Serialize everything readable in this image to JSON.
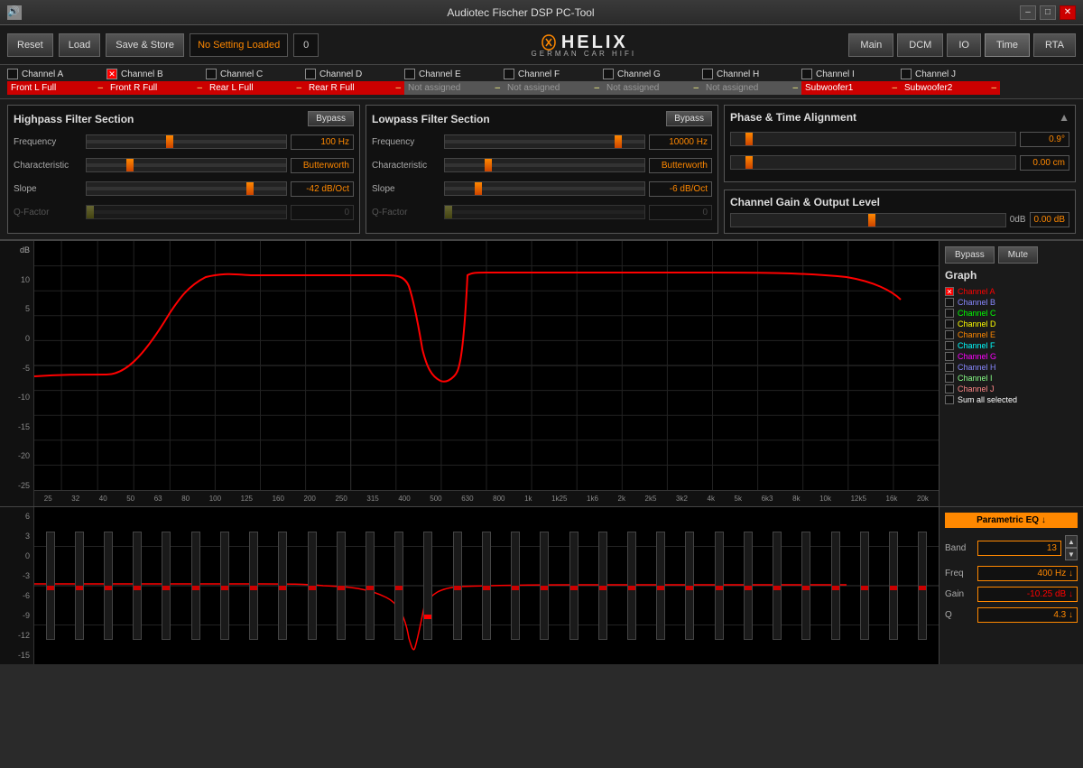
{
  "titlebar": {
    "title": "Audiotec Fischer DSP PC-Tool",
    "minimize_label": "–",
    "maximize_label": "□",
    "close_label": "✕"
  },
  "toolbar": {
    "reset_label": "Reset",
    "load_label": "Load",
    "save_label": "Save & Store",
    "no_setting_label": "No Setting Loaded",
    "setting_num": "0",
    "nav": {
      "main_label": "Main",
      "dcm_label": "DCM",
      "io_label": "IO",
      "time_label": "Time",
      "rta_label": "RTA"
    }
  },
  "channels": [
    {
      "id": "A",
      "label": "Channel A",
      "checked": false,
      "value": "Front L Full",
      "active": true
    },
    {
      "id": "B",
      "label": "Channel B",
      "checked": true,
      "value": "Front R Full",
      "active": true
    },
    {
      "id": "C",
      "label": "Channel C",
      "checked": false,
      "value": "Rear L Full",
      "active": true
    },
    {
      "id": "D",
      "label": "Channel D",
      "checked": false,
      "value": "Rear R Full",
      "active": true
    },
    {
      "id": "E",
      "label": "Channel E",
      "checked": false,
      "value": "Not assigned",
      "active": false
    },
    {
      "id": "F",
      "label": "Channel F",
      "checked": false,
      "value": "Not assigned",
      "active": false
    },
    {
      "id": "G",
      "label": "Channel G",
      "checked": false,
      "value": "Not assigned",
      "active": false
    },
    {
      "id": "H",
      "label": "Channel H",
      "checked": false,
      "value": "Not assigned",
      "active": false
    },
    {
      "id": "I",
      "label": "Channel I",
      "checked": false,
      "value": "Subwoofer1",
      "active": true
    },
    {
      "id": "J",
      "label": "Channel J",
      "checked": false,
      "value": "Subwoofer2",
      "active": true
    }
  ],
  "highpass": {
    "title": "Highpass Filter Section",
    "bypass_label": "Bypass",
    "frequency_label": "Frequency",
    "frequency_value": "100 Hz",
    "characteristic_label": "Characteristic",
    "characteristic_value": "Butterworth",
    "slope_label": "Slope",
    "slope_value": "-42 dB/Oct",
    "qfactor_label": "Q-Factor",
    "qfactor_value": "0"
  },
  "lowpass": {
    "title": "Lowpass Filter Section",
    "bypass_label": "Bypass",
    "frequency_label": "Frequency",
    "frequency_value": "10000 Hz",
    "characteristic_label": "Characteristic",
    "characteristic_value": "Butterworth",
    "slope_label": "Slope",
    "slope_value": "-6 dB/Oct",
    "qfactor_label": "Q-Factor",
    "qfactor_value": "0"
  },
  "phase_time": {
    "title": "Phase & Time Alignment",
    "phase_value": "0.9°",
    "distance_value": "0.00 cm",
    "scroll_arrow": "▲"
  },
  "channel_gain": {
    "title": "Channel Gain & Output Level",
    "db_label": "0dB",
    "value": "0.00 dB"
  },
  "graph": {
    "y_labels": [
      "10",
      "5",
      "0",
      "-5",
      "-10",
      "-15",
      "-20",
      "-25"
    ],
    "db_label": "dB",
    "x_labels": [
      "25",
      "32",
      "40",
      "50",
      "63",
      "80",
      "100",
      "125",
      "160",
      "200",
      "250",
      "315",
      "400",
      "500",
      "630",
      "800",
      "1k",
      "1k25",
      "1k6",
      "2k",
      "2k5",
      "3k2",
      "4k",
      "5k",
      "6k3",
      "8k",
      "10k",
      "12k5",
      "16k",
      "20k"
    ],
    "bypass_label": "Bypass",
    "mute_label": "Mute",
    "graph_title": "Graph",
    "channels": [
      {
        "label": "Channel A",
        "checked": true,
        "color": "#f00"
      },
      {
        "label": "Channel B",
        "checked": false,
        "color": "#88f"
      },
      {
        "label": "Channel C",
        "checked": false,
        "color": "#0f0"
      },
      {
        "label": "Channel D",
        "checked": false,
        "color": "#ff0"
      },
      {
        "label": "Channel E",
        "checked": false,
        "color": "#f80"
      },
      {
        "label": "Channel F",
        "checked": false,
        "color": "#0ff"
      },
      {
        "label": "Channel G",
        "checked": false,
        "color": "#f0f"
      },
      {
        "label": "Channel H",
        "checked": false,
        "color": "#88f"
      },
      {
        "label": "Channel I",
        "checked": false,
        "color": "#8f8"
      },
      {
        "label": "Channel J",
        "checked": false,
        "color": "#f88"
      },
      {
        "label": "Sum all selected",
        "checked": false,
        "color": "#fff"
      }
    ]
  },
  "eq_section": {
    "type_label": "Parametric EQ ↓",
    "band_label": "Band",
    "band_value": "13",
    "freq_label": "Freq",
    "freq_value": "400 Hz ↓",
    "gain_label": "Gain",
    "gain_value": "-10.25 dB ↓",
    "q_label": "Q",
    "q_value": "4.3 ↓",
    "y_labels": [
      "6",
      "3",
      "0",
      "-3",
      "-6",
      "-9",
      "-12",
      "-15"
    ],
    "num_bands": 31
  }
}
